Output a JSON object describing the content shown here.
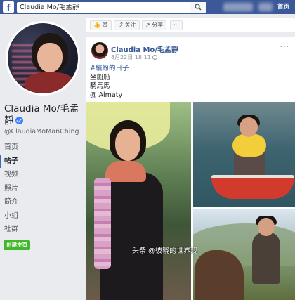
{
  "topbar": {
    "logo_letter": "f",
    "search_value": "Claudia Mo/毛孟靜",
    "search_icon": "search-icon",
    "home_label": "首页",
    "brand_color": "#3b5998"
  },
  "profile": {
    "name": "Claudia Mo/毛孟靜",
    "handle": "@ClaudiaMoManChing",
    "verified_icon": "verified-badge-icon"
  },
  "nav": {
    "items": [
      {
        "label": "首页",
        "active": false
      },
      {
        "label": "帖子",
        "active": true
      },
      {
        "label": "视频",
        "active": false
      },
      {
        "label": "照片",
        "active": false
      },
      {
        "label": "简介",
        "active": false
      },
      {
        "label": "小组",
        "active": false
      },
      {
        "label": "社群",
        "active": false
      }
    ],
    "create_page_label": "创建主页"
  },
  "actionbar": {
    "like_label": "赞",
    "follow_label": "关注",
    "share_label": "分享",
    "more_label": "···"
  },
  "post": {
    "author": "Claudia Mo/毛孟靜",
    "date": "8月22日 18:11",
    "more_label": "···",
    "hashtag": "#繽紛的日子",
    "line1": "坐船船",
    "line2": "騎馬馬",
    "line3": "@ Almaty"
  },
  "watermark": "头条 @彼晓的世界观"
}
